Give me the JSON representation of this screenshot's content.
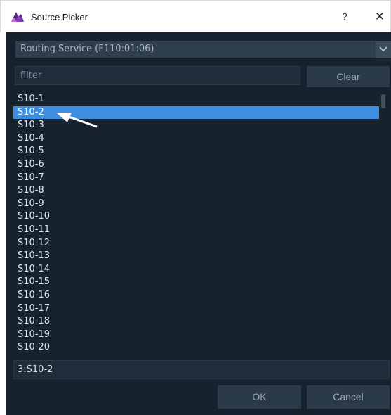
{
  "window": {
    "title": "Source Picker",
    "help_label": "?",
    "close_label": "✕"
  },
  "source_select": {
    "selected": "Routing Service (F110:01:06)"
  },
  "filter": {
    "value": "",
    "placeholder": "filter"
  },
  "clear_label": "Clear",
  "sources": {
    "items": [
      "S10-1",
      "S10-2",
      "S10-3",
      "S10-4",
      "S10-5",
      "S10-6",
      "S10-7",
      "S10-8",
      "S10-9",
      "S10-10",
      "S10-11",
      "S10-12",
      "S10-13",
      "S10-14",
      "S10-15",
      "S10-16",
      "S10-17",
      "S10-18",
      "S10-19",
      "S10-20"
    ],
    "selected": "S10-2"
  },
  "selection_field": {
    "value": "3:S10-2"
  },
  "ok_label": "OK",
  "cancel_label": "Cancel",
  "colors": {
    "dialog_bg": "#16232e",
    "selected_row": "#3d8ee0",
    "button_bg": "#2b3a48"
  },
  "icons": {
    "app": "source-picker-app-icon",
    "dropdown": "chevron-down-icon",
    "pointer": "arrow-pointer-icon"
  }
}
